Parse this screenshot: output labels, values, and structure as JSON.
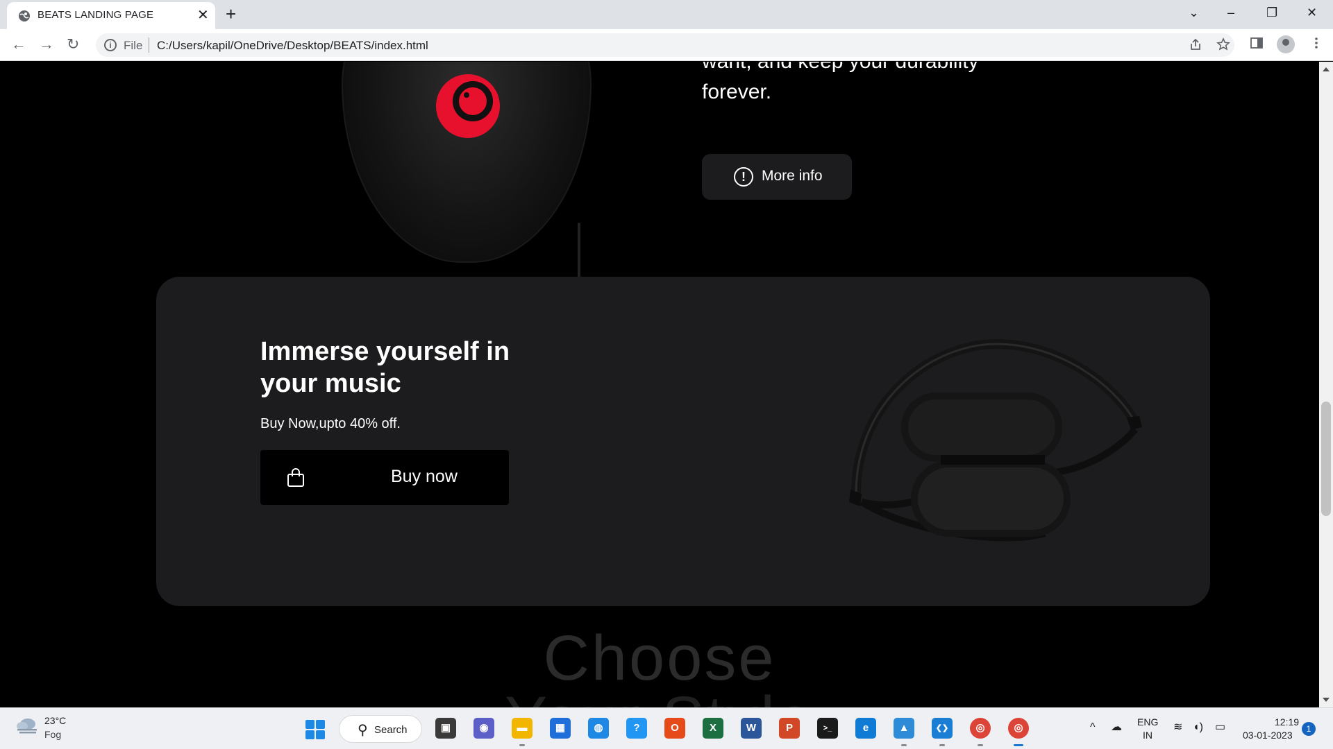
{
  "browser": {
    "tab_title": "BEATS LANDING PAGE",
    "tab_close": "✕",
    "new_tab": "+",
    "scheme_label": "File",
    "url": "C:/Users/kapil/OneDrive/Desktop/BEATS/index.html",
    "window_controls": {
      "list": "⌄",
      "minimize": "–",
      "restore": "❐",
      "close": "✕"
    },
    "nav": {
      "back": "←",
      "forward": "→",
      "reload": "↻"
    },
    "info_glyph": "i"
  },
  "page": {
    "intro_text": "want, and keep your durability forever.",
    "more_info_label": "More info",
    "more_info_glyph": "!",
    "promo": {
      "heading": "Immerse yourself in your music",
      "subtext": "Buy Now,upto 40% off.",
      "buy_label": "Buy now"
    },
    "choose_title_line1": "Choose",
    "choose_title_line2": "Your Style"
  },
  "taskbar": {
    "weather_temp": "23°C",
    "weather_desc": "Fog",
    "search_label": "Search",
    "search_glyph": "⚲",
    "apps": [
      {
        "name": "task-view",
        "glyph": "▣",
        "color": "#3a3a3a"
      },
      {
        "name": "teams",
        "glyph": "◉",
        "color": "#5b5fc7"
      },
      {
        "name": "file-explorer",
        "glyph": "▬",
        "color": "#f2b600"
      },
      {
        "name": "microsoft-store",
        "glyph": "▦",
        "color": "#1e6fd9"
      },
      {
        "name": "app-blue",
        "glyph": "◍",
        "color": "#1e88e5"
      },
      {
        "name": "app-help",
        "glyph": "?",
        "color": "#2196f3"
      },
      {
        "name": "office",
        "glyph": "O",
        "color": "#e64a19"
      },
      {
        "name": "excel",
        "glyph": "X",
        "color": "#1d6f42"
      },
      {
        "name": "word",
        "glyph": "W",
        "color": "#2b579a"
      },
      {
        "name": "powerpoint",
        "glyph": "P",
        "color": "#d24726"
      },
      {
        "name": "terminal",
        "glyph": ">_",
        "color": "#1a1a1a"
      },
      {
        "name": "edge",
        "glyph": "e",
        "color": "#0f7bd4"
      },
      {
        "name": "photos",
        "glyph": "▲",
        "color": "#2e8bd8"
      },
      {
        "name": "vscode",
        "glyph": "❮❯",
        "color": "#1a7fd4"
      },
      {
        "name": "chrome",
        "glyph": "◎",
        "color": "#db4437"
      },
      {
        "name": "chrome-active",
        "glyph": "◎",
        "color": "#db4437"
      }
    ],
    "tray_chevron": "^",
    "tray_cloud": "☁",
    "lang_line1": "ENG",
    "lang_line2": "IN",
    "wifi": "≋",
    "volume": "◖)",
    "battery": "▭",
    "time": "12:19",
    "date": "03-01-2023",
    "notification_count": "1"
  }
}
